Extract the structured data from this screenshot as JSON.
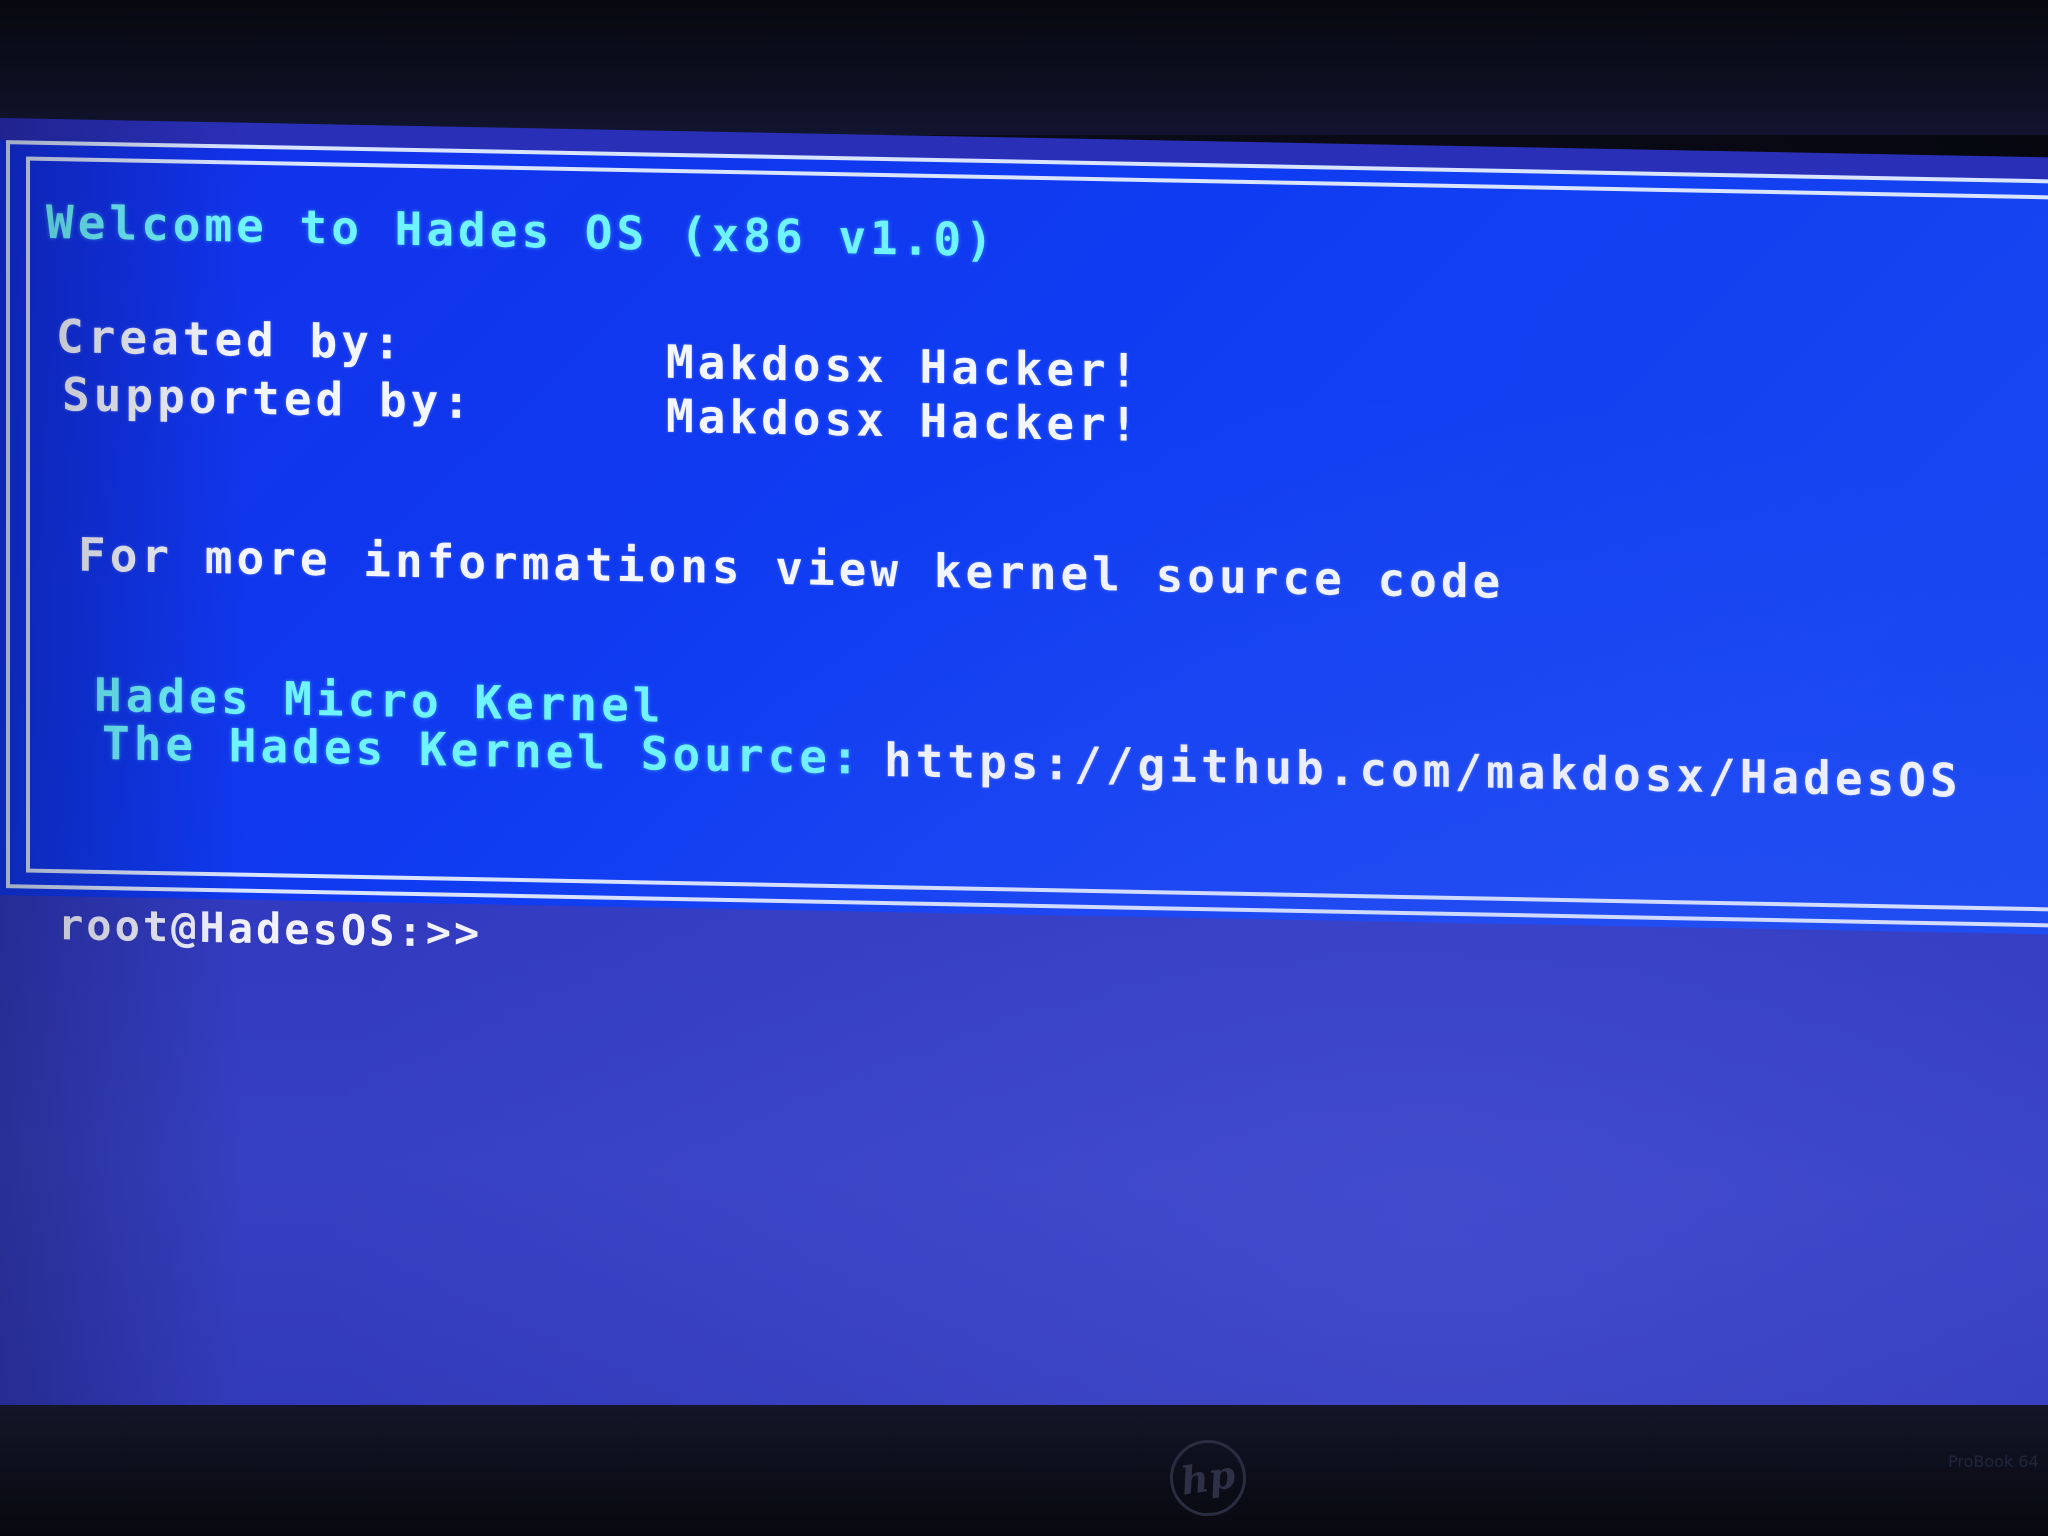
{
  "banner": {
    "welcome": "Welcome to Hades OS (x86 v1.0)",
    "created_by_label": "Created by:",
    "created_by_value": "Makdosx Hacker!",
    "supported_by_label": "Supported by:",
    "supported_by_value": "Makdosx Hacker!",
    "info_line": "For more informations view kernel source code",
    "kernel_name": "Hades Micro Kernel",
    "kernel_source_label": "The Hades Kernel Source:",
    "kernel_source_url": "https://github.com/makdosx/HadesOS"
  },
  "terminal": {
    "prompt": "root@HadesOS:>>",
    "input_value": ""
  },
  "hardware": {
    "logo_text": "hp",
    "model_text": "ProBook 64"
  },
  "colors": {
    "banner_background": "#0f3cf2",
    "console_background": "#2e35be",
    "cyan_text": "#6ff4ff",
    "white_text": "#f4f6ff",
    "frame": "#d9e4ff"
  }
}
